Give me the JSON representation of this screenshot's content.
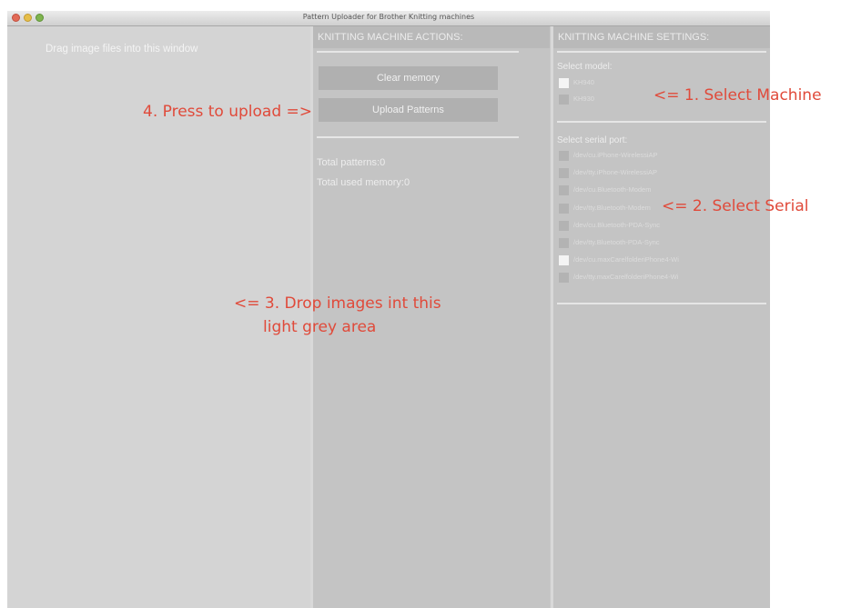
{
  "window": {
    "title": "Pattern Uploader for Brother Knitting machines"
  },
  "drop_area": {
    "hint": "Drag image files into this window"
  },
  "actions": {
    "header": "KNITTING MACHINE ACTIONS:",
    "clear_label": "Clear memory",
    "upload_label": "Upload Patterns",
    "total_patterns": "Total patterns:0",
    "total_memory": "Total used memory:0"
  },
  "settings": {
    "header": "KNITTING MACHINE SETTINGS:",
    "model_label": "Select model:",
    "models": [
      {
        "name": "KH940",
        "checked": true
      },
      {
        "name": "KH930",
        "checked": false
      }
    ],
    "port_label": "Select serial port:",
    "ports": [
      {
        "name": "/dev/cu.iPhone-WirelessiAP",
        "checked": false
      },
      {
        "name": "/dev/tty.iPhone-WirelessiAP",
        "checked": false
      },
      {
        "name": "/dev/cu.Bluetooth-Modem",
        "checked": false
      },
      {
        "name": "/dev/tty.Bluetooth-Modem",
        "checked": false
      },
      {
        "name": "/dev/cu.Bluetooth-PDA-Sync",
        "checked": false
      },
      {
        "name": "/dev/tty.Bluetooth-PDA-Sync",
        "checked": false
      },
      {
        "name": "/dev/cu.maxCarelfolderiPhone4-Wi",
        "checked": true
      },
      {
        "name": "/dev/tty.maxCarelfolderiPhone4-Wi",
        "checked": false
      }
    ]
  },
  "annotations": {
    "step1": "<= 1. Select Machine",
    "step2": "<= 2. Select Serial",
    "step3_line1": "<= 3. Drop images int this",
    "step3_line2": "light grey area",
    "step4": "4. Press to upload =>"
  }
}
